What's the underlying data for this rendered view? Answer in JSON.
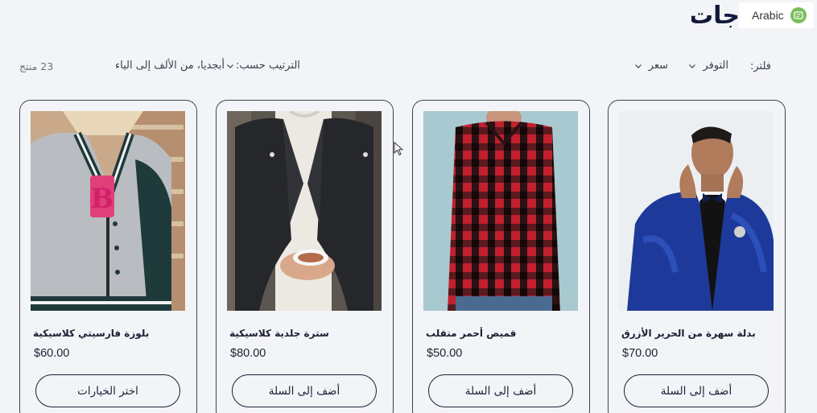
{
  "header": {
    "title": "جات",
    "language": "Arabic"
  },
  "toolbar": {
    "filter_label": "فلتر:",
    "availability_label": "التوفر",
    "price_label": "سعر",
    "sort_label": "الترتيب حسب:",
    "sort_value": "أبجديا، من الألف إلى الياء",
    "product_count": "23 منتج"
  },
  "products": [
    {
      "name": "بلوزة فارسيتي كلاسيكية",
      "price": "$60.00",
      "button": "اختر الخيارات"
    },
    {
      "name": "سترة جلدية كلاسيكية",
      "price": "$80.00",
      "button": "أضف إلى السلة"
    },
    {
      "name": "قميص أحمر متقلب",
      "price": "$50.00",
      "button": "أضف إلى السلة"
    },
    {
      "name": "بدلة سهرة من الحرير الأزرق",
      "price": "$70.00",
      "button": "أضف إلى السلة"
    }
  ],
  "colors": {
    "accent": "#1b2138",
    "background": "#f3f4f7",
    "language_icon": "#7cbd5a"
  },
  "icons": {
    "language": "translate-icon",
    "dropdown": "chevron-down-icon"
  }
}
